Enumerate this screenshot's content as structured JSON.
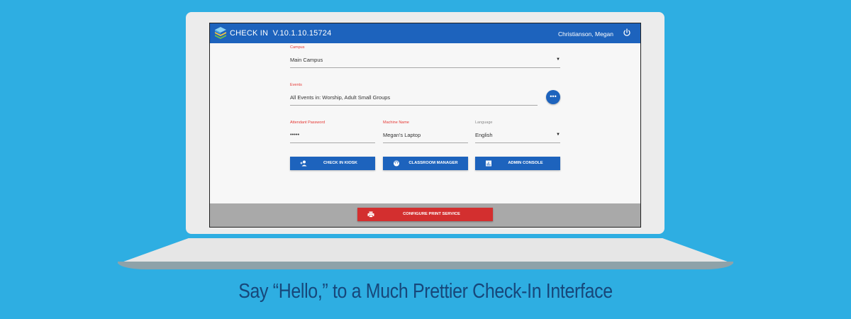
{
  "app": {
    "title": "CHECK IN  V.10.1.10.15724",
    "user": "Christianson, Megan"
  },
  "form": {
    "campus": {
      "label": "Campus",
      "value": "Main Campus"
    },
    "events": {
      "label": "Events",
      "value": "All Events in: Worship, Adult Small Groups",
      "more": "•••"
    },
    "attendant_password": {
      "label": "Attendant Password",
      "value": "•••••"
    },
    "machine_name": {
      "label": "Machine Name",
      "value": "Megan's Laptop"
    },
    "language": {
      "label": "Language",
      "value": "English"
    }
  },
  "buttons": {
    "check_in_kiosk": "CHECK IN KIOSK",
    "classroom_manager": "CLASSROOM MANAGER",
    "admin_console": "ADMIN CONSOLE",
    "configure_print": "CONFIGURE PRINT SERVICE"
  },
  "icons": {
    "logo": "stacked-layers-icon",
    "power": "power-icon",
    "check_in": "add-person-icon",
    "classroom": "face-icon",
    "admin": "chart-icon",
    "print": "printer-icon",
    "dropdown": "caret-down-icon"
  },
  "colors": {
    "background": "#2eaee2",
    "primary": "#1d63bd",
    "required_label": "#e53935",
    "print_button": "#d32f2f",
    "footer": "#a9a9a9",
    "tagline": "#17477a"
  },
  "tagline": "Say “Hello,” to a Much Prettier Check-In Interface"
}
